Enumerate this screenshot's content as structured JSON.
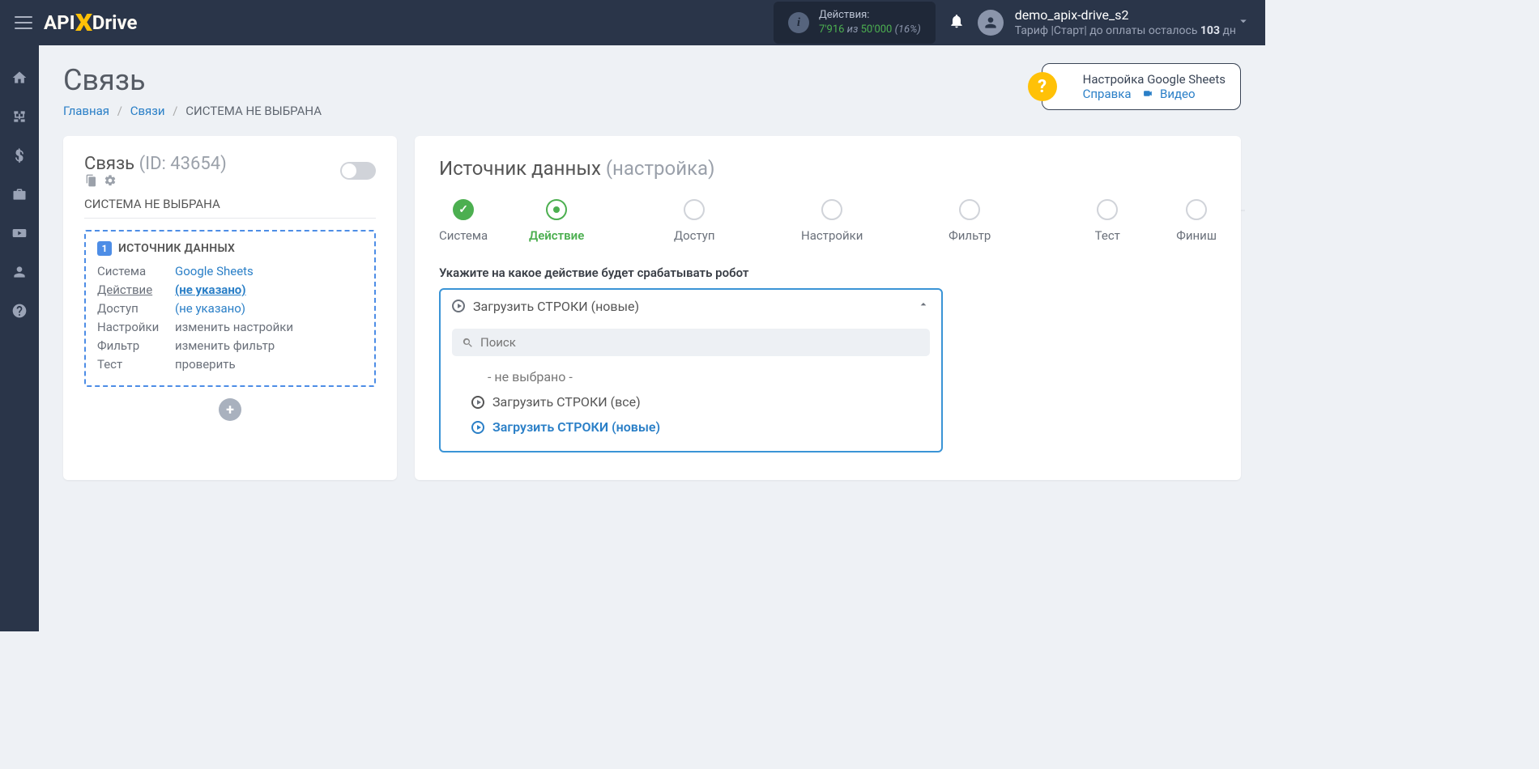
{
  "logo": {
    "p1": "API",
    "p2": "Drive"
  },
  "header": {
    "actions_label": "Действия:",
    "used": "7'916",
    "iz": "из",
    "limit": "50'000",
    "pct": "(16%)",
    "user": "demo_apix-drive_s2",
    "tariff_prefix": "Тариф |Старт|  до оплаты осталось ",
    "tariff_days": "103",
    "tariff_suffix": " дн"
  },
  "page": {
    "title": "Связь",
    "crumbs": {
      "home": "Главная",
      "links": "Связи",
      "current": "СИСТЕМА НЕ ВЫБРАНА"
    }
  },
  "help": {
    "title": "Настройка Google Sheets",
    "ref": "Справка",
    "video": "Видео"
  },
  "left": {
    "title": "Связь",
    "id_label": "(ID: 43654)",
    "sysname": "СИСТЕМА НЕ ВЫБРАНА",
    "block_num": "1",
    "block_title": "ИСТОЧНИК ДАННЫХ",
    "rows": [
      {
        "k": "Система",
        "v": "Google Sheets",
        "link": true
      },
      {
        "k": "Действие",
        "v": "(не указано)",
        "link": true,
        "active": true
      },
      {
        "k": "Доступ",
        "v": "(не указано)",
        "link": true
      },
      {
        "k": "Настройки",
        "v": "изменить настройки"
      },
      {
        "k": "Фильтр",
        "v": "изменить фильтр"
      },
      {
        "k": "Тест",
        "v": "проверить"
      }
    ]
  },
  "right": {
    "title": "Источник данных",
    "subtitle": "(настройка)",
    "steps": [
      "Система",
      "Действие",
      "Доступ",
      "Настройки",
      "Фильтр",
      "Тест",
      "Финиш"
    ],
    "field_label": "Укажите на какое действие будет срабатывать робот",
    "selected": "Загрузить СТРОКИ (новые)",
    "search_placeholder": "Поиск",
    "options": {
      "none": "- не выбрано -",
      "all": "Загрузить СТРОКИ (все)",
      "new": "Загрузить СТРОКИ (новые)"
    }
  }
}
